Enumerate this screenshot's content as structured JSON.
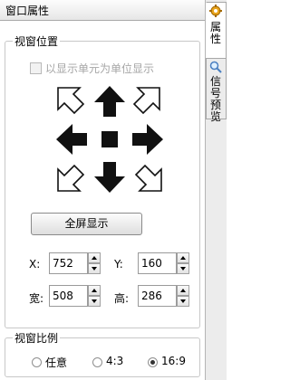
{
  "panel": {
    "title": "窗口属性"
  },
  "tabs": [
    {
      "label": "属性",
      "icon": "gear-icon",
      "active": true
    },
    {
      "label": "信号预览",
      "icon": "magnifier-icon",
      "active": false
    }
  ],
  "view_position": {
    "group_label": "视窗位置",
    "unit_checkbox_label": "以显示单元为单位显示",
    "unit_checkbox_checked": false,
    "fullscreen_button": "全屏显示",
    "x_label": "X:",
    "x_value": "752",
    "y_label": "Y:",
    "y_value": "160",
    "w_label": "宽:",
    "w_value": "508",
    "h_label": "高:",
    "h_value": "286"
  },
  "aspect_ratio": {
    "group_label": "视窗比例",
    "options": [
      "任意",
      "4:3",
      "16:9"
    ],
    "selected": "16:9"
  }
}
